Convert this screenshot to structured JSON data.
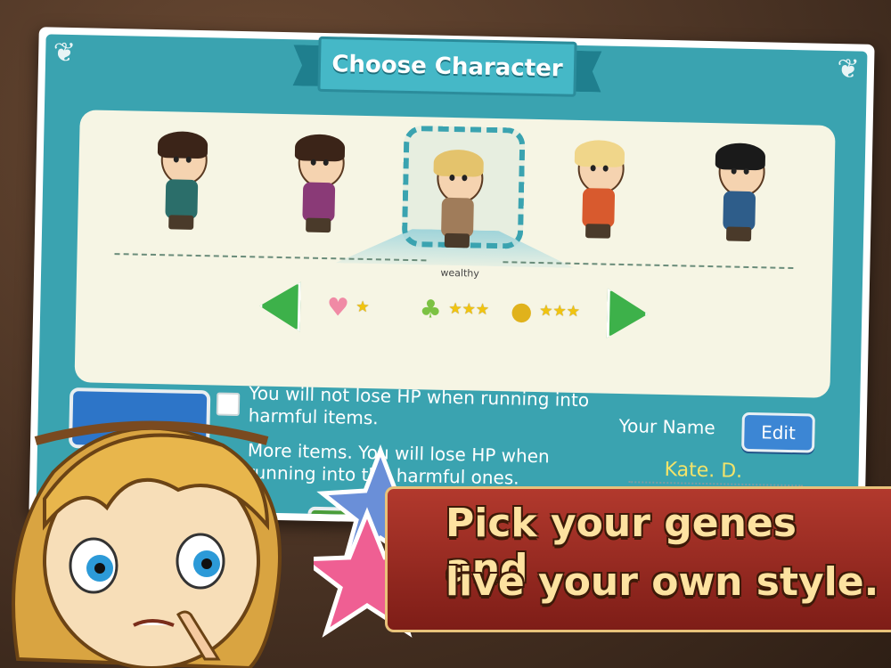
{
  "screen": {
    "title": "Choose Character"
  },
  "character_select": {
    "characters": [
      {
        "id": "curly-hair-man",
        "hair": "#3b2418",
        "outfit": "#2b6e6a",
        "selected": false
      },
      {
        "id": "ponytail-woman",
        "hair": "#3b2418",
        "outfit": "#8a3a77",
        "selected": false
      },
      {
        "id": "blond-businessman",
        "hair": "#e4c36c",
        "outfit": "#a07c5a",
        "selected": true
      },
      {
        "id": "blonde-woman",
        "hair": "#f0d68a",
        "outfit": "#d85a2e",
        "selected": false
      },
      {
        "id": "glasses-man",
        "hair": "#1a1a1a",
        "outfit": "#2e5d8a",
        "selected": false
      }
    ],
    "selected_trait": "wealthy",
    "stats": [
      {
        "icon": "heart-icon",
        "stars": 1
      },
      {
        "icon": "money-bag-icon",
        "stars": 3
      },
      {
        "icon": "coin-icon",
        "stars": 3
      }
    ]
  },
  "options": [
    {
      "text": "You will not lose HP when running into harmful items.",
      "checked": false
    },
    {
      "text": "More items. You will lose HP when running into the harmful ones.",
      "checked": false
    }
  ],
  "player": {
    "label": "Your Name",
    "edit_label": "Edit",
    "name": "Kate. D."
  },
  "promo": {
    "line1": "Pick your genes and",
    "line2": "live your own style."
  },
  "colors": {
    "accent": "#3aa3b0",
    "arrow": "#3db14a",
    "banner": "#9e2b22",
    "banner_text": "#fde2a0"
  }
}
